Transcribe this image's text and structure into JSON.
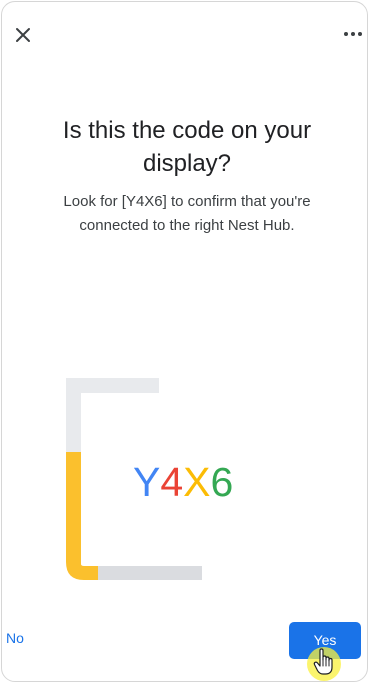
{
  "header": {
    "close_icon": "close-icon",
    "more_icon": "more-horizontal-icon"
  },
  "content": {
    "title": "Is this the code on your display?",
    "subtitle": "Look for [Y4X6] to confirm that you're connected to the right Nest Hub."
  },
  "code": {
    "characters": [
      "Y",
      "4",
      "X",
      "6"
    ],
    "colors": [
      "#4285F4",
      "#EA4335",
      "#FBBC05",
      "#34A853"
    ]
  },
  "illustration": {
    "bracket_gray": "#dadce0",
    "bracket_yellow": "#fbc02d"
  },
  "actions": {
    "no_label": "No",
    "yes_label": "Yes"
  },
  "colors": {
    "accent": "#1a73e8",
    "cursor_highlight": "#faf03c"
  }
}
